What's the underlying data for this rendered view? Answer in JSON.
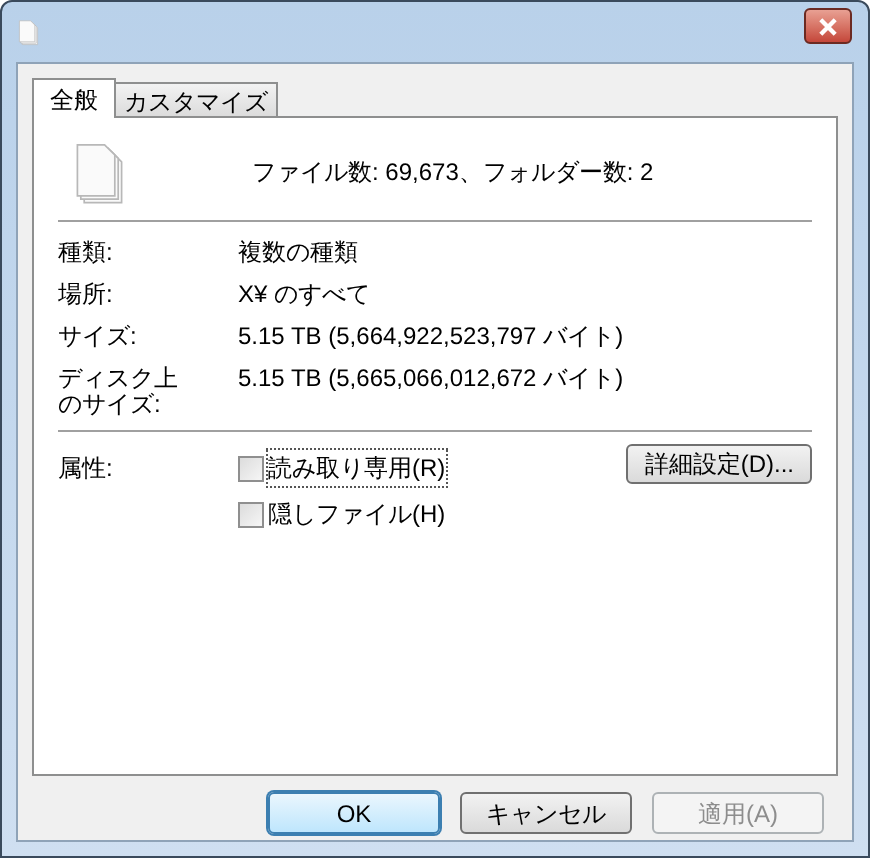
{
  "tabs": [
    {
      "label": "全般",
      "selected": true
    },
    {
      "label": "カスタマイズ",
      "selected": false
    }
  ],
  "summary": "ファイル数: 69,673、フォルダー数: 2",
  "properties": [
    {
      "label": "種類:",
      "value": "複数の種類"
    },
    {
      "label": "場所:",
      "value": "X¥ のすべて"
    },
    {
      "label": "サイズ:",
      "value": "5.15 TB (5,664,922,523,797 バイト)"
    },
    {
      "label": "ディスク上のサイズ:",
      "value": "5.15 TB (5,665,066,012,672 バイト)"
    }
  ],
  "attributes": {
    "label": "属性:",
    "options": [
      {
        "label": "読み取り専用(R)",
        "checked": false,
        "focused": true
      },
      {
        "label": "隠しファイル(H)",
        "checked": false,
        "focused": false
      }
    ],
    "advanced_button": "詳細設定(D)..."
  },
  "buttons": [
    {
      "label": "OK",
      "default": true,
      "disabled": false
    },
    {
      "label": "キャンセル",
      "default": false,
      "disabled": false
    },
    {
      "label": "適用(A)",
      "default": false,
      "disabled": true
    }
  ]
}
